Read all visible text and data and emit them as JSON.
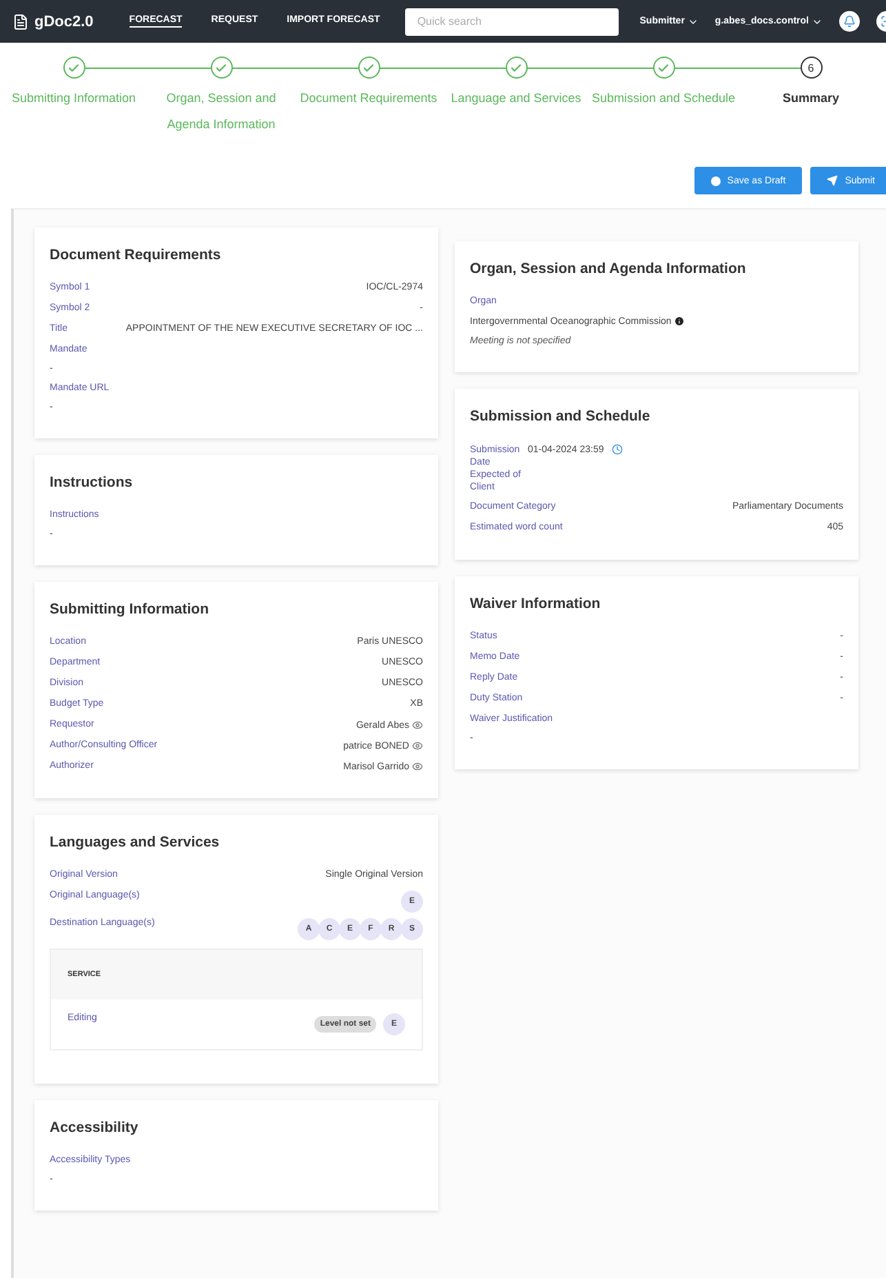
{
  "navbar": {
    "brand": "gDoc2.0",
    "links": [
      {
        "label": "FORECAST",
        "selected": true
      },
      {
        "label": "REQUEST",
        "selected": false
      },
      {
        "label": "IMPORT FORECAST",
        "selected": false
      }
    ],
    "search": {
      "placeholder": "Quick search"
    },
    "role": "Submitter",
    "user": "g.abes_docs.control"
  },
  "steps": [
    {
      "label": "Submitting Information",
      "done": true
    },
    {
      "label": "Organ, Session and Agenda Information",
      "done": true
    },
    {
      "label": "Document Requirements",
      "done": true
    },
    {
      "label": "Language and Services",
      "done": true
    },
    {
      "label": "Submission and Schedule",
      "done": true
    },
    {
      "label": "Summary",
      "done": false,
      "number": "6"
    }
  ],
  "actions": [
    "Save as Draft",
    "Submit"
  ],
  "left_cards": [
    {
      "title": "Document Requirements",
      "rows": [
        {
          "kind": "pair",
          "label": "Symbol 1",
          "value": "IOC/CL-2974"
        },
        {
          "kind": "pair",
          "label": "Symbol 2",
          "value": "-"
        },
        {
          "kind": "pair",
          "label": "Title",
          "value": "APPOINTMENT OF THE NEW EXECUTIVE SECRETARY OF IOC ..."
        },
        {
          "kind": "block",
          "label": "Mandate",
          "value": "-"
        },
        {
          "kind": "block",
          "label": "Mandate URL",
          "value": "-"
        }
      ]
    },
    {
      "title": "Instructions",
      "rows": [
        {
          "kind": "block",
          "label": "Instructions",
          "value": "-"
        }
      ]
    },
    {
      "title": "Submitting Information",
      "rows": [
        {
          "kind": "pair",
          "label": "Location",
          "value": "Paris UNESCO"
        },
        {
          "kind": "pair",
          "label": "Department",
          "value": "UNESCO"
        },
        {
          "kind": "pair",
          "label": "Division",
          "value": "UNESCO"
        },
        {
          "kind": "pair",
          "label": "Budget Type",
          "value": "XB"
        },
        {
          "kind": "pair",
          "label": "Requestor",
          "value": "Gerald Abes",
          "viewable": true
        },
        {
          "kind": "pair",
          "label": "Author/Consulting Officer",
          "value": "patrice BONED",
          "viewable": true
        },
        {
          "kind": "pair",
          "label": "Authorizer",
          "value": "Marisol Garrido",
          "viewable": true
        }
      ]
    },
    {
      "title": "Languages and Services",
      "rows": [
        {
          "kind": "pair",
          "label": "Original Version",
          "value": "Single Original Version"
        },
        {
          "kind": "chips",
          "label": "Original Language(s)",
          "chips": [
            "E"
          ]
        },
        {
          "kind": "chips",
          "label": "Destination Language(s)",
          "chips": [
            "A",
            "C",
            "E",
            "F",
            "R",
            "S"
          ]
        },
        {
          "kind": "services",
          "header": "SERVICE",
          "services": [
            {
              "name": "Editing",
              "level": "Level not set",
              "chips": [
                "E"
              ]
            }
          ]
        }
      ]
    },
    {
      "title": "Accessibility",
      "rows": [
        {
          "kind": "block",
          "label": "Accessibility Types",
          "value": "-"
        }
      ]
    }
  ],
  "right_cards": [
    {
      "title": "Organ, Session and Agenda Information",
      "rows": [
        {
          "kind": "organ",
          "label": "Organ",
          "value": "Intergovernmental Oceanographic Commission",
          "note": "Meeting is not specified"
        }
      ]
    },
    {
      "title": "Submission and Schedule",
      "rows": [
        {
          "kind": "date",
          "label": "Submission Date Expected of Client",
          "value": "01-04-2024 23:59"
        },
        {
          "kind": "pair",
          "label": "Document Category",
          "value": "Parliamentary Documents"
        },
        {
          "kind": "pair",
          "label": "Estimated word count",
          "value": "405"
        }
      ]
    },
    {
      "title": "Waiver Information",
      "rows": [
        {
          "kind": "pair",
          "label": "Status",
          "value": "-"
        },
        {
          "kind": "pair",
          "label": "Memo Date",
          "value": "-"
        },
        {
          "kind": "pair",
          "label": "Reply Date",
          "value": "-"
        },
        {
          "kind": "pair",
          "label": "Duty Station",
          "value": "-"
        },
        {
          "kind": "block",
          "label": "Waiver Justification",
          "value": "-"
        }
      ]
    }
  ]
}
